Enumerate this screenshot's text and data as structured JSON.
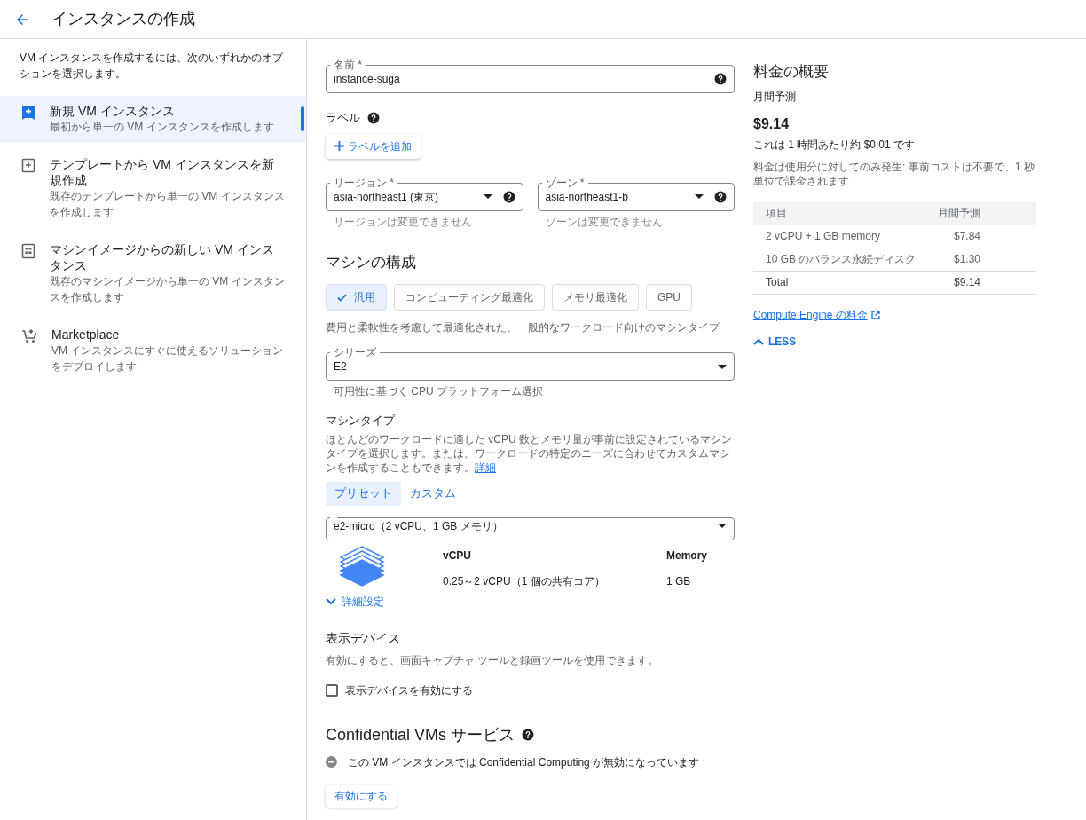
{
  "header": {
    "title": "インスタンスの作成"
  },
  "sidebar": {
    "intro": "VM インスタンスを作成するには、次のいずれかのオプションを選択します。",
    "items": [
      {
        "kind": "new",
        "title": "新規 VM インスタンス",
        "description": "最初から単一の VM インスタンスを作成します",
        "selected": true
      },
      {
        "kind": "template",
        "title": "テンプレートから VM インスタンスを新規作成",
        "description": "既存のテンプレートから単一の VM インスタンスを作成します",
        "selected": false
      },
      {
        "kind": "image",
        "title": "マシンイメージからの新しい VM インスタンス",
        "description": "既存のマシンイメージから単一の VM インスタンスを作成します",
        "selected": false
      },
      {
        "kind": "marketplace",
        "title": "Marketplace",
        "description": "VM インスタンスにすぐに使えるソリューションをデプロイします",
        "selected": false
      }
    ]
  },
  "form": {
    "name_field": {
      "label": "名前 *",
      "value": "instance-suga"
    },
    "labels": {
      "heading": "ラベル",
      "add_button": "ラベルを追加"
    },
    "region": {
      "label": "リージョン *",
      "value": "asia-northeast1 (東京)",
      "hint": "リージョンは変更できません"
    },
    "zone": {
      "label": "ゾーン *",
      "value": "asia-northeast1-b",
      "hint": "ゾーンは変更できません"
    },
    "machine_config": {
      "heading": "マシンの構成",
      "families": [
        {
          "label": "汎用",
          "selected": true
        },
        {
          "label": "コンピューティング最適化",
          "selected": false
        },
        {
          "label": "メモリ最適化",
          "selected": false
        },
        {
          "label": "GPU",
          "selected": false
        }
      ],
      "description": "費用と柔軟性を考慮して最適化された、一般的なワークロード向けのマシンタイプ"
    },
    "series": {
      "label": "シリーズ",
      "value": "E2",
      "hint": "可用性に基づく CPU プラットフォーム選択"
    },
    "machine_type": {
      "heading": "マシンタイプ",
      "description": "ほとんどのワークロードに適した vCPU 数とメモリ量が事前に設定されているマシンタイプを選択します。または、ワークロードの特定のニーズに合わせてカスタムマシンを作成することもできます。",
      "link": "詳細",
      "tabs": [
        {
          "label": "プリセット",
          "selected": true
        },
        {
          "label": "カスタム",
          "selected": false
        }
      ],
      "value": "e2-micro（2 vCPU、1 GB メモリ）",
      "specs": [
        {
          "heading": "vCPU",
          "value": "0.25～2 vCPU（1 個の共有コア）"
        },
        {
          "heading": "Memory",
          "value": "1 GB"
        }
      ],
      "advanced": "詳細設定"
    },
    "display_device": {
      "heading": "表示デバイス",
      "description": "有効にすると、画面キャプチャ ツールと録画ツールを使用できます。",
      "checkbox": {
        "label": "表示デバイスを有効にする",
        "checked": false
      }
    },
    "confidential": {
      "heading": "Confidential VMs サービス",
      "status": "この VM インスタンスでは Confidential Computing が無効になっています",
      "button": "有効にする"
    }
  },
  "pricing": {
    "title": "料金の概要",
    "subtitle": "月間予測",
    "total": "$9.14",
    "hourly": "これは 1 時間あたり約 $0.01 です",
    "note": "料金は使用分に対してのみ発生: 事前コストは不要で、1 秒単位で課金されます",
    "table": {
      "columns": [
        "項目",
        "月間予測"
      ],
      "rows": [
        {
          "kind": "item",
          "item": "2 vCPU + 1 GB memory",
          "cost": "$7.84"
        },
        {
          "kind": "item",
          "item": "10 GB のバランス永続ディスク",
          "cost": "$1.30"
        },
        {
          "kind": "total",
          "item": "Total",
          "cost": "$9.14"
        }
      ]
    },
    "link": "Compute Engine の料金",
    "toggle": "LESS"
  }
}
